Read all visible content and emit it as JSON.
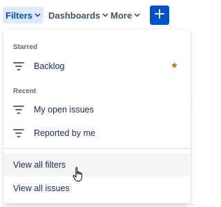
{
  "nav": {
    "filters": "Filters",
    "dashboards": "Dashboards",
    "more": "More",
    "create_icon": "plus-icon"
  },
  "dropdown": {
    "starred_title": "Starred",
    "starred_items": [
      {
        "label": "Backlog",
        "icon": "filter-icon",
        "starred": true
      }
    ],
    "recent_title": "Recent",
    "recent_items": [
      {
        "label": "My open issues",
        "icon": "filter-icon"
      },
      {
        "label": "Reported by me",
        "icon": "filter-icon"
      }
    ],
    "footer": {
      "view_all_filters": "View all filters",
      "view_all_issues": "View all issues"
    }
  },
  "colors": {
    "accent": "#0052cc",
    "active_bg": "#deebff",
    "star": "#b8860b"
  }
}
